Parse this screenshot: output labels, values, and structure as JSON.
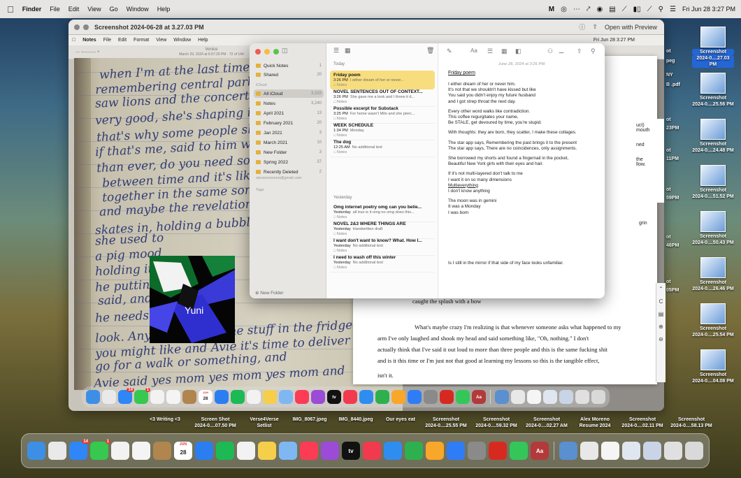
{
  "menubar": {
    "items": [
      "Finder",
      "File",
      "Edit",
      "View",
      "Go",
      "Window",
      "Help"
    ],
    "datetime": "Fri Jun 28  3:27 PM"
  },
  "preview": {
    "title": "Screenshot 2024-06-28 at 3.27.03 PM",
    "open_with": "Open with Preview",
    "inner_menu": [
      "Notes",
      "File",
      "Edit",
      "Format",
      "View",
      "Window",
      "Help"
    ],
    "inner_datetime": "Fri Jun 28 3:27 PM",
    "inner_title": "Venice",
    "inner_subtitle": "March 29, 2024 at 6:07:29 PM · 72 of 144"
  },
  "handwriting": [
    "when I'm at the last time, the",
    "remembering central park when we",
    "saw lions and the concert",
    "very  good, she's shaping in the",
    "that's why some people should have",
    "if that's me, said to him with me",
    "than ever, do you need some, not for",
    "between time and it's like all time",
    "together in the same song, track",
    "and maybe the revelation",
    "skates in, holding a bubble",
    "she used to",
    "a pig  mood",
    "holding it",
    "he putting in",
    "said, and",
    "he needs me",
    "look.  Anyway, here some stuff in the fridge",
    "you  might  like  and  Avie  it's  time  to  deliver",
    "go  for  a  walk  or  something, and",
    "Avie  said  yes  mom  yes  mom  yes mom  and"
  ],
  "overlay_label": "Yuni",
  "notes": {
    "sidebar_sections": {
      "top": [
        {
          "label": "Quick Notes",
          "count": "1"
        },
        {
          "label": "Shared",
          "count": "20"
        }
      ],
      "icloud_header": "iCloud",
      "icloud": [
        {
          "label": "All iCloud",
          "count": "3,333",
          "selected": true
        },
        {
          "label": "Notes",
          "count": "3,240"
        },
        {
          "label": "April 2021",
          "count": "13"
        },
        {
          "label": "February 2021",
          "count": "20"
        },
        {
          "label": "Jan 2021",
          "count": "3"
        },
        {
          "label": "March 2021",
          "count": "10"
        },
        {
          "label": "New Folder",
          "count": "3"
        },
        {
          "label": "Spring 2022",
          "count": "37"
        },
        {
          "label": "Recently Deleted",
          "count": "2"
        }
      ],
      "account": "stevenmoreno@gmail.com",
      "tags": "Tags",
      "new_folder": "New Folder"
    },
    "list": {
      "today_header": "Today",
      "today": [
        {
          "title": "Friday poem",
          "time": "3:26 PM",
          "preview": "I either dream of her or never...",
          "folder": "Notes",
          "selected": true
        },
        {
          "title": "NOVEL SENTENCES OUT OF CONTEXT...",
          "time": "3:26 PM",
          "preview": "She gave me a look and I threw it d...",
          "folder": "Notes"
        },
        {
          "title": "Possible excerpt for Substack",
          "time": "3:25 PM",
          "preview": "For home wasn't Milo and she pierc...",
          "folder": "Notes"
        },
        {
          "title": "WEEK SCHEDULE",
          "time": "1:34 PM",
          "preview": "Monday",
          "folder": "Notes"
        },
        {
          "title": "The dog",
          "time": "12:25 AM",
          "preview": "No additional text",
          "folder": "Notes"
        }
      ],
      "yesterday_header": "Yesterday",
      "yesterday": [
        {
          "title": "Omg internet poetry omg can you belie...",
          "time": "Yesterday",
          "preview": "all true is it omg no omg does this...",
          "folder": "Notes"
        },
        {
          "title": "NOVEL 2&3 WHERE THINGS ARE",
          "time": "Yesterday",
          "preview": "Handwritten draft",
          "folder": "Notes"
        },
        {
          "title": "I want don't want to know? What. How I...",
          "time": "Yesterday",
          "preview": "No additional text",
          "folder": "Notes"
        },
        {
          "title": "I need to wash off this winter",
          "time": "Yesterday",
          "preview": "No additional text",
          "folder": "Notes"
        }
      ]
    },
    "editor": {
      "date": "June 28, 2024 at 3:26 PM",
      "title": "Friday poem",
      "lines": [
        "I either dream of her or never him.",
        "It's not that we shouldn't have kissed but like",
        "You said you didn't enjoy my future husband",
        "and I got strep throat the next day.",
        "",
        "Every other word walks like contradiction.",
        "This coffee regurgitates your name,",
        "Be STALE, get devoured by time, you're stupid.",
        "",
        "With thoughts: they are born, they scatter, I make these collages.",
        "",
        "The star app says, Remembering the past brings it to the present",
        "The star app says, There are no coincidences, only assignments.",
        "",
        "She borrowed my shorts and found a fingernail in the pocket,",
        "Beautiful New York girls with their eyes and hair.",
        "",
        "If it's not multi-layered don't talk to me",
        "I want it on so many dimensions",
        "Multieverything",
        "I don't know anything",
        "",
        "The moon was in gemini",
        "It was a Monday",
        "I was born"
      ],
      "last_line": "Is I still in the mirror if that side of my face looks unfamiliar."
    }
  },
  "document": {
    "lines": [
      "caught the splash with a bow",
      "What's maybe crazy I'm realizing is that whenever someone asks what happened to my",
      "arm I've only laughed and shook my head and said something like, \"Oh, nothing.\" I don't",
      "actually think that I've said it out loud to more than three people and this is the same fucking shit",
      "and is it this time or I'm just not that good at learning my lessons so this is the tangible effect,",
      "isn't it."
    ],
    "fragments": [
      "uct)",
      "mouth",
      "ned",
      "the",
      "llow.",
      "grin"
    ]
  },
  "desktop": [
    {
      "label": "Screenshot",
      "sub": "2024-0....27.03 PM",
      "selected": true
    },
    {
      "label": "Screenshot",
      "sub": "2024-0....25.56 PM"
    },
    {
      "label": "Screenshot",
      "sub": "2024-0....24.48 PM"
    },
    {
      "label": "Screenshot",
      "sub": "2024-0....51.52 PM"
    },
    {
      "label": "Screenshot",
      "sub": "2024-0....50.43 PM"
    },
    {
      "label": "Screenshot",
      "sub": "2024-0....26.46 PM"
    },
    {
      "label": "Screenshot",
      "sub": "2024-0....25.54 PM"
    },
    {
      "label": "Screenshot",
      "sub": "2024-0....04.08 PM"
    }
  ],
  "desktop_partial": [
    "ot",
    "peg",
    "NY",
    "B .pdf",
    "ot",
    "23PM",
    "ot",
    "11PM",
    "ot",
    "59PM",
    "ot",
    "46PM",
    "ot",
    "05PM"
  ],
  "bottom_labels": [
    {
      "l1": "<3 Writing <3",
      "l2": ""
    },
    {
      "l1": "Screen Shot",
      "l2": "2024-0....07.50 PM"
    },
    {
      "l1": "Verse4Verse",
      "l2": "Setlist"
    },
    {
      "l1": "IMG_8067.jpeg",
      "l2": ""
    },
    {
      "l1": "IMG_8440.jpeg",
      "l2": ""
    },
    {
      "l1": "Our eyes eat",
      "l2": ""
    },
    {
      "l1": "Screenshot",
      "l2": "2024-0....25.55 PM"
    },
    {
      "l1": "Screenshot",
      "l2": "2024-0....59.32 PM"
    },
    {
      "l1": "Screenshot",
      "l2": "2024-0....02.27 AM"
    },
    {
      "l1": "Alex Moreno",
      "l2": "Resume 2024"
    },
    {
      "l1": "Screenshot",
      "l2": "2024-0....02.11 PM"
    },
    {
      "l1": "Screenshot",
      "l2": "2024-0....58.13 PM"
    }
  ],
  "dock": {
    "calendar_month": "JUN",
    "calendar_day": "28",
    "mail_badge": "14",
    "messages_badge": "1",
    "appletv_label": "tv",
    "acrobat_label": "Aa"
  }
}
